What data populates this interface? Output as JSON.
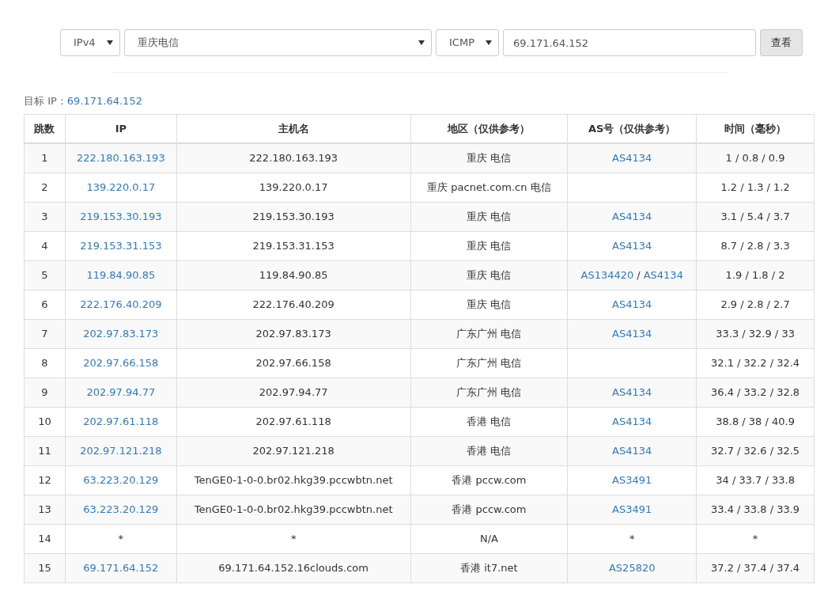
{
  "query": {
    "protocol_version": "IPv4",
    "node": "重庆电信",
    "method": "ICMP",
    "target": "69.171.64.152",
    "submit": "查看"
  },
  "target_label": "目标 IP：",
  "target_value": "69.171.64.152",
  "table": {
    "columns": [
      "跳数",
      "IP",
      "主机名",
      "地区（仅供参考）",
      "AS号（仅供参考）",
      "时间（毫秒）"
    ],
    "rows": [
      {
        "hop": "1",
        "ip": {
          "text": "222.180.163.193",
          "link": true
        },
        "host": "222.180.163.193",
        "region": "重庆 电信",
        "as": [
          {
            "text": "AS4134",
            "link": true
          }
        ],
        "time": "1 / 0.8 / 0.9"
      },
      {
        "hop": "2",
        "ip": {
          "text": "139.220.0.17",
          "link": true
        },
        "host": "139.220.0.17",
        "region": "重庆 pacnet.com.cn 电信",
        "as": [],
        "time": "1.2 / 1.3 / 1.2"
      },
      {
        "hop": "3",
        "ip": {
          "text": "219.153.30.193",
          "link": true
        },
        "host": "219.153.30.193",
        "region": "重庆 电信",
        "as": [
          {
            "text": "AS4134",
            "link": true
          }
        ],
        "time": "3.1 / 5.4 / 3.7"
      },
      {
        "hop": "4",
        "ip": {
          "text": "219.153.31.153",
          "link": true
        },
        "host": "219.153.31.153",
        "region": "重庆 电信",
        "as": [
          {
            "text": "AS4134",
            "link": true
          }
        ],
        "time": "8.7 / 2.8 / 3.3"
      },
      {
        "hop": "5",
        "ip": {
          "text": "119.84.90.85",
          "link": true
        },
        "host": "119.84.90.85",
        "region": "重庆 电信",
        "as": [
          {
            "text": "AS134420",
            "link": true
          },
          {
            "text": "/",
            "link": false
          },
          {
            "text": "AS4134",
            "link": true
          }
        ],
        "time": "1.9 / 1.8 / 2"
      },
      {
        "hop": "6",
        "ip": {
          "text": "222.176.40.209",
          "link": true
        },
        "host": "222.176.40.209",
        "region": "重庆 电信",
        "as": [
          {
            "text": "AS4134",
            "link": true
          }
        ],
        "time": "2.9 / 2.8 / 2.7"
      },
      {
        "hop": "7",
        "ip": {
          "text": "202.97.83.173",
          "link": true
        },
        "host": "202.97.83.173",
        "region": "广东广州 电信",
        "as": [
          {
            "text": "AS4134",
            "link": true
          }
        ],
        "time": "33.3 / 32.9 / 33"
      },
      {
        "hop": "8",
        "ip": {
          "text": "202.97.66.158",
          "link": true
        },
        "host": "202.97.66.158",
        "region": "广东广州 电信",
        "as": [],
        "time": "32.1 / 32.2 / 32.4"
      },
      {
        "hop": "9",
        "ip": {
          "text": "202.97.94.77",
          "link": true
        },
        "host": "202.97.94.77",
        "region": "广东广州 电信",
        "as": [
          {
            "text": "AS4134",
            "link": true
          }
        ],
        "time": "36.4 / 33.2 / 32.8"
      },
      {
        "hop": "10",
        "ip": {
          "text": "202.97.61.118",
          "link": true
        },
        "host": "202.97.61.118",
        "region": "香港 电信",
        "as": [
          {
            "text": "AS4134",
            "link": true
          }
        ],
        "time": "38.8 / 38 / 40.9"
      },
      {
        "hop": "11",
        "ip": {
          "text": "202.97.121.218",
          "link": true
        },
        "host": "202.97.121.218",
        "region": "香港 电信",
        "as": [
          {
            "text": "AS4134",
            "link": true
          }
        ],
        "time": "32.7 / 32.6 / 32.5"
      },
      {
        "hop": "12",
        "ip": {
          "text": "63.223.20.129",
          "link": true
        },
        "host": "TenGE0-1-0-0.br02.hkg39.pccwbtn.net",
        "region": "香港 pccw.com",
        "as": [
          {
            "text": "AS3491",
            "link": true
          }
        ],
        "time": "34 / 33.7 / 33.8"
      },
      {
        "hop": "13",
        "ip": {
          "text": "63.223.20.129",
          "link": true
        },
        "host": "TenGE0-1-0-0.br02.hkg39.pccwbtn.net",
        "region": "香港 pccw.com",
        "as": [
          {
            "text": "AS3491",
            "link": true
          }
        ],
        "time": "33.4 / 33.8 / 33.9"
      },
      {
        "hop": "14",
        "ip": {
          "text": "*",
          "link": false
        },
        "host": "*",
        "region": "N/A",
        "as": [
          {
            "text": "*",
            "link": false
          }
        ],
        "time": "*"
      },
      {
        "hop": "15",
        "ip": {
          "text": "69.171.64.152",
          "link": true
        },
        "host": "69.171.64.152.16clouds.com",
        "region": "香港 it7.net",
        "as": [
          {
            "text": "AS25820",
            "link": true
          }
        ],
        "time": "37.2 / 37.4 / 37.4"
      }
    ]
  }
}
